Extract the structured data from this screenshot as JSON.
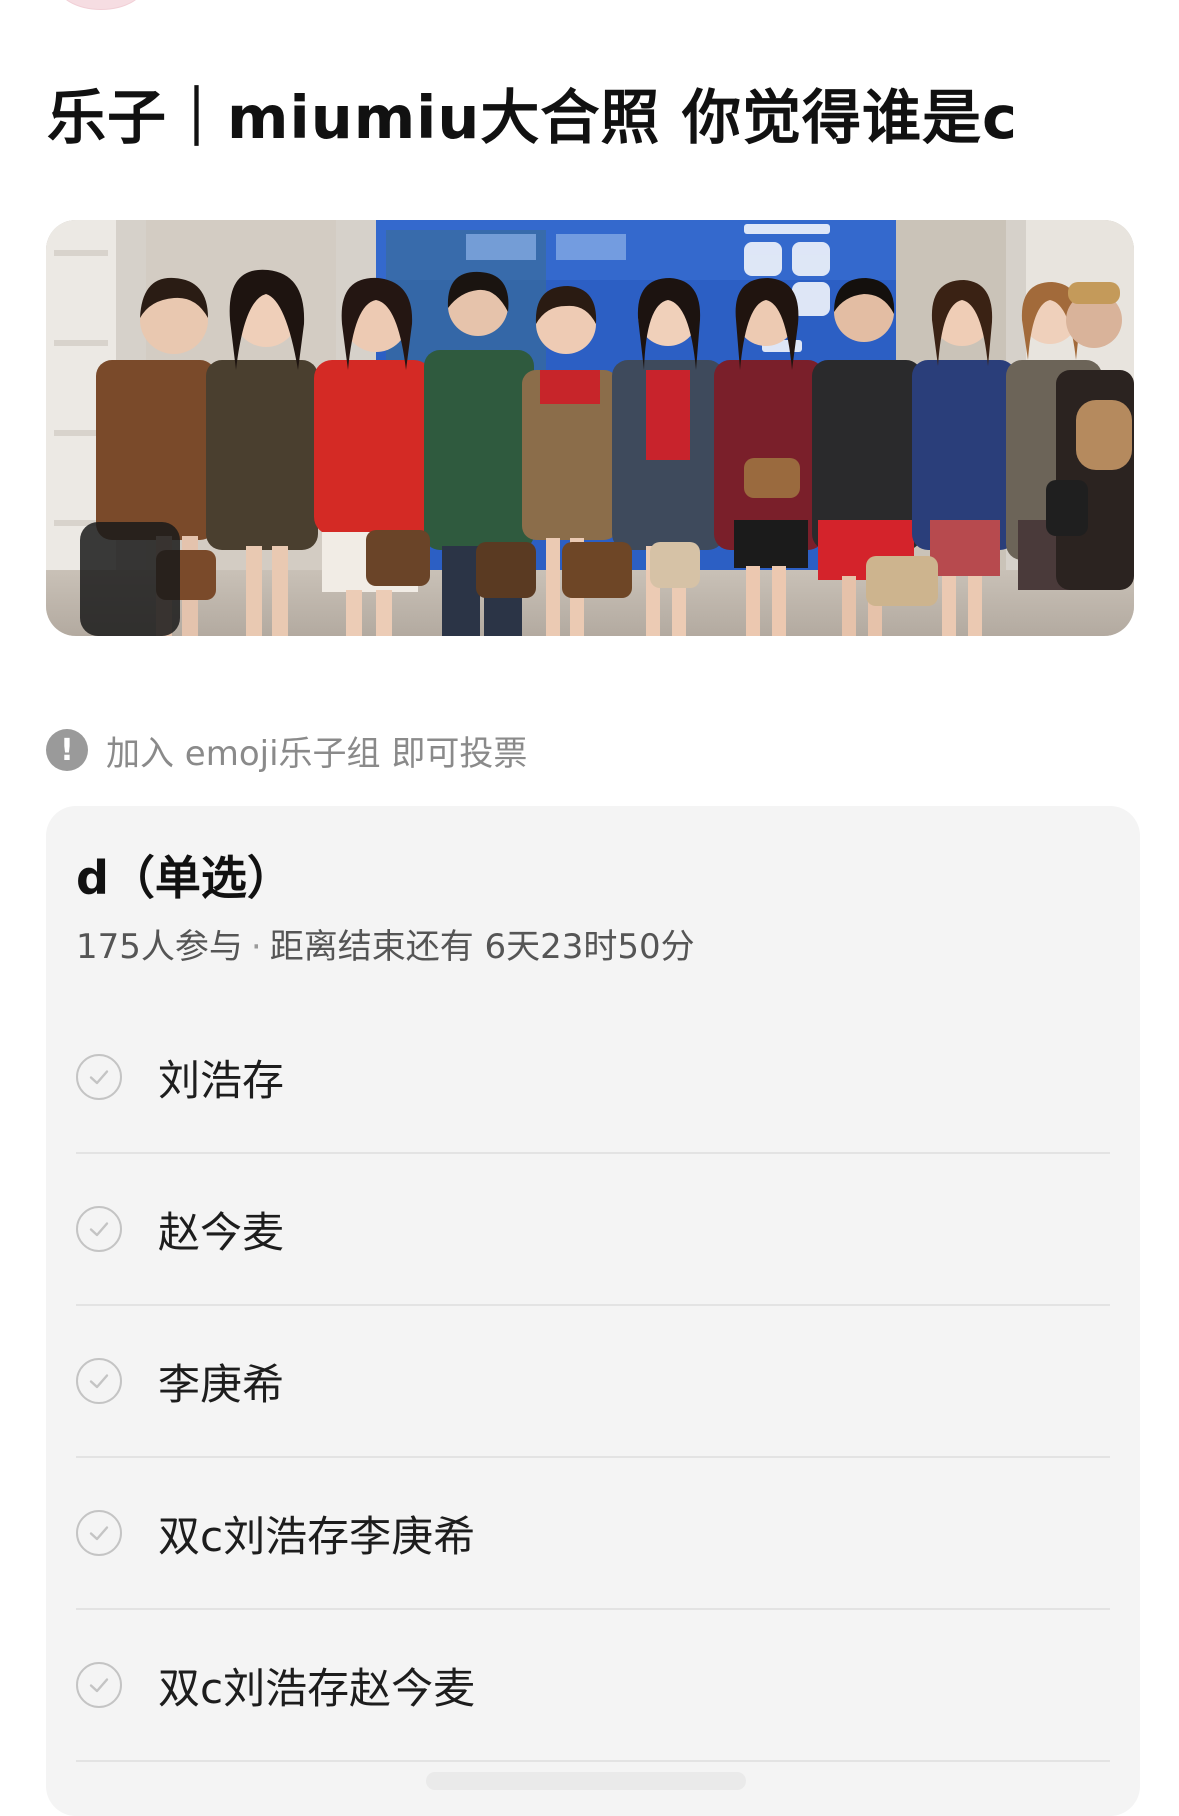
{
  "post": {
    "title": "乐子｜miumiu大合照 你觉得谁是c"
  },
  "notice": {
    "icon": "exclamation-icon",
    "text": "加入 emoji乐子组 即可投票"
  },
  "poll": {
    "title": "d（单选）",
    "participants": "175人参与",
    "separator": "·",
    "countdown": "距离结束还有 6天23时50分",
    "options": [
      {
        "label": "刘浩存",
        "icon": "check-circle-icon"
      },
      {
        "label": "赵今麦",
        "icon": "check-circle-icon"
      },
      {
        "label": "李庚希",
        "icon": "check-circle-icon"
      },
      {
        "label": "双c刘浩存李庚希",
        "icon": "check-circle-icon"
      },
      {
        "label": "双c刘浩存赵今麦",
        "icon": "check-circle-icon"
      }
    ]
  },
  "colors": {
    "card_background": "#f4f4f4",
    "notice_icon": "#9a9a9a",
    "backdrop_blue": "#2c5fc4"
  }
}
